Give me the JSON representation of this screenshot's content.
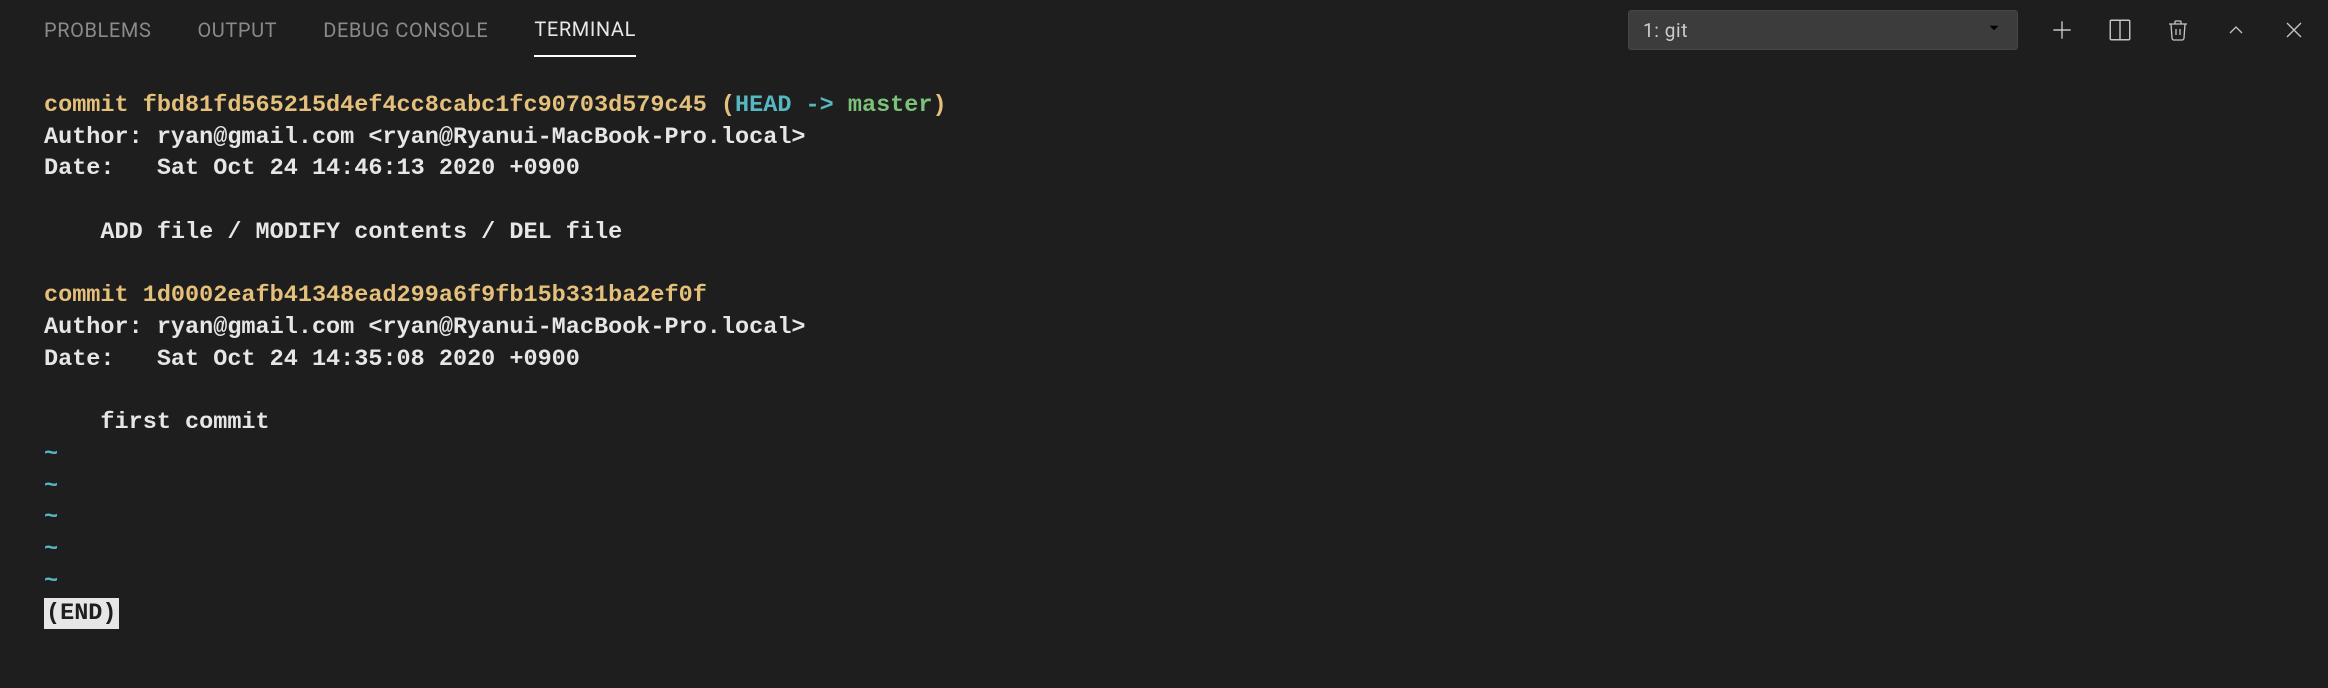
{
  "tabs": {
    "problems": "PROBLEMS",
    "output": "OUTPUT",
    "debug_console": "DEBUG CONSOLE",
    "terminal": "TERMINAL"
  },
  "dropdown": {
    "label": "1: git"
  },
  "log": {
    "commits": [
      {
        "commit_kw": "commit ",
        "hash": "fbd81fd565215d4ef4cc8cabc1fc90703d579c45",
        "ref_open": " (",
        "head": "HEAD -> ",
        "branch": "master",
        "ref_close": ")",
        "author_line": "Author: ryan@gmail.com <ryan@Ryanui-MacBook-Pro.local>",
        "date_line": "Date:   Sat Oct 24 14:46:13 2020 +0900",
        "message": "    ADD file / MODIFY contents / DEL file"
      },
      {
        "commit_kw": "commit ",
        "hash": "1d0002eafb41348ead299a6f9fb15b331ba2ef0f",
        "author_line": "Author: ryan@gmail.com <ryan@Ryanui-MacBook-Pro.local>",
        "date_line": "Date:   Sat Oct 24 14:35:08 2020 +0900",
        "message": "    first commit"
      }
    ],
    "tilde": "~",
    "end": "(END)"
  }
}
